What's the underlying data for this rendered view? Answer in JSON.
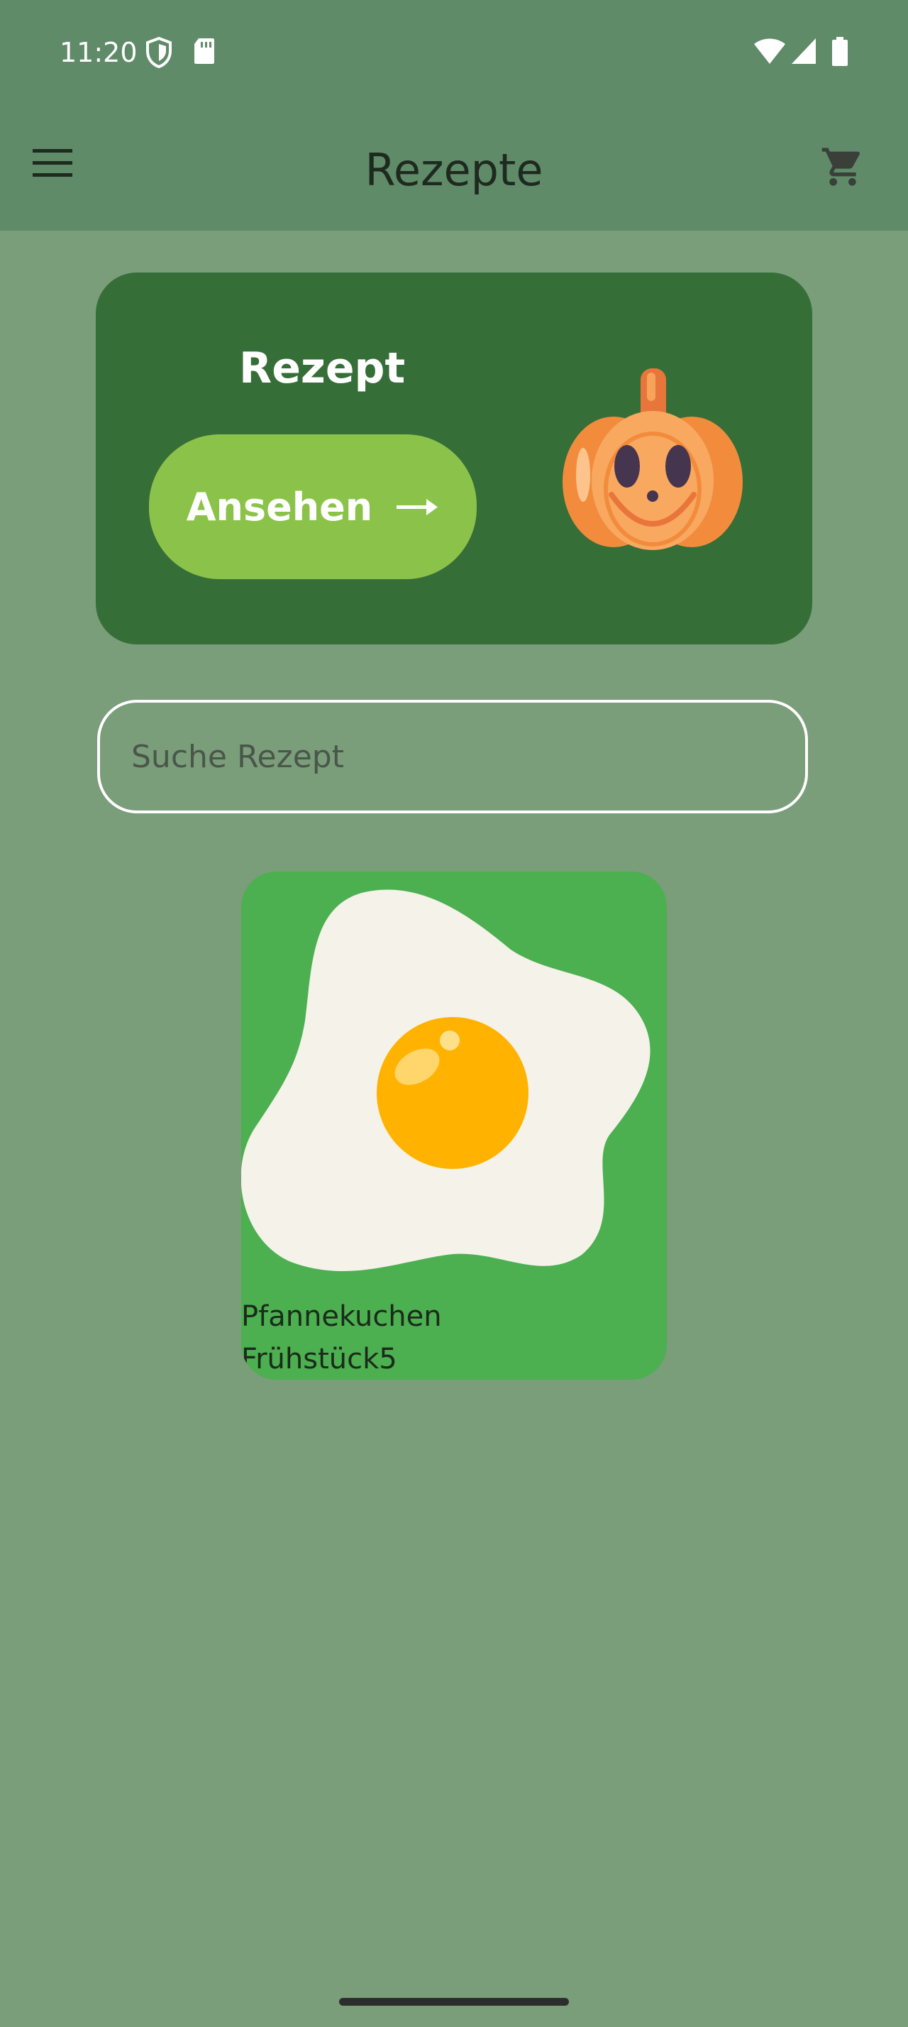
{
  "status_bar": {
    "time": "11:20"
  },
  "app_bar": {
    "title": "Rezepte"
  },
  "promo": {
    "title": "Rezept",
    "button_label": "Ansehen"
  },
  "search": {
    "placeholder": "Suche Rezept",
    "value": ""
  },
  "recipes": [
    {
      "name": "Pfannekuchen",
      "category": "Frühstück5"
    }
  ],
  "colors": {
    "background": "#7a9d7a",
    "app_bar": "#5f8b69",
    "promo_card": "#366e38",
    "promo_button": "#8bc34a",
    "recipe_card": "#4caf50"
  },
  "icons": {
    "menu": "menu-icon",
    "cart": "cart-icon",
    "arrow": "arrow-right-icon",
    "pumpkin": "pumpkin-icon",
    "egg": "fried-egg-icon"
  }
}
